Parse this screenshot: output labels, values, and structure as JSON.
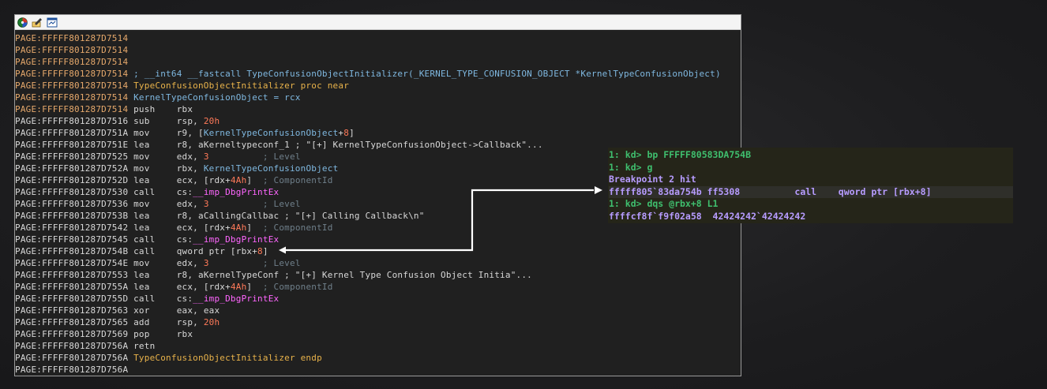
{
  "toolbar": {
    "icons": [
      "graph-view-icon",
      "edit-icon",
      "proximity-view-icon"
    ]
  },
  "disasm": [
    {
      "addr": "PAGE:FFFFF801287D7514",
      "addr_style": "user",
      "mnem": "",
      "ops": []
    },
    {
      "addr": "PAGE:FFFFF801287D7514",
      "addr_style": "user",
      "mnem": "",
      "ops": []
    },
    {
      "addr": "PAGE:FFFFF801287D7514",
      "addr_style": "user",
      "mnem": "",
      "ops": []
    },
    {
      "addr": "PAGE:FFFFF801287D7514",
      "addr_style": "user",
      "mnem": "",
      "ops": [
        {
          "t": "; __int64 __fastcall TypeConfusionObjectInitializer(_KERNEL_TYPE_CONFUSION_OBJECT *KernelTypeConfusionObject)",
          "c": "sym"
        }
      ]
    },
    {
      "addr": "PAGE:FFFFF801287D7514",
      "addr_style": "user",
      "mnem": "",
      "ops": [
        {
          "t": "TypeConfusionObjectInitializer proc near",
          "c": "proc"
        }
      ]
    },
    {
      "addr": "PAGE:FFFFF801287D7514",
      "addr_style": "user",
      "mnem": "",
      "ops": [
        {
          "t": "KernelTypeConfusionObject = rcx",
          "c": "sym"
        }
      ]
    },
    {
      "addr": "PAGE:FFFFF801287D7514",
      "addr_style": "user",
      "mnem": "push",
      "ops": [
        {
          "t": "rbx",
          "c": "op"
        }
      ]
    },
    {
      "addr": "PAGE:FFFFF801287D7516",
      "addr_style": "plain",
      "mnem": "sub",
      "ops": [
        {
          "t": "rsp, ",
          "c": "op"
        },
        {
          "t": "20h",
          "c": "num"
        }
      ]
    },
    {
      "addr": "PAGE:FFFFF801287D751A",
      "addr_style": "plain",
      "mnem": "mov",
      "ops": [
        {
          "t": "r9, [",
          "c": "op"
        },
        {
          "t": "KernelTypeConfusionObject",
          "c": "sym"
        },
        {
          "t": "+",
          "c": "op"
        },
        {
          "t": "8",
          "c": "num"
        },
        {
          "t": "]",
          "c": "op"
        }
      ]
    },
    {
      "addr": "PAGE:FFFFF801287D751E",
      "addr_style": "plain",
      "mnem": "lea",
      "ops": [
        {
          "t": "r8, aKerneltypeconf_1 ; \"[+] KernelTypeConfusionObject->Callback\"...",
          "c": "op"
        }
      ]
    },
    {
      "addr": "PAGE:FFFFF801287D7525",
      "addr_style": "plain",
      "mnem": "mov",
      "ops": [
        {
          "t": "edx, ",
          "c": "op"
        },
        {
          "t": "3",
          "c": "num"
        },
        {
          "t": "          ; Level",
          "c": "cmt"
        }
      ]
    },
    {
      "addr": "PAGE:FFFFF801287D752A",
      "addr_style": "plain",
      "mnem": "mov",
      "ops": [
        {
          "t": "rbx, ",
          "c": "op"
        },
        {
          "t": "KernelTypeConfusionObject",
          "c": "sym"
        }
      ]
    },
    {
      "addr": "PAGE:FFFFF801287D752D",
      "addr_style": "plain",
      "mnem": "lea",
      "ops": [
        {
          "t": "ecx, [rdx+",
          "c": "op"
        },
        {
          "t": "4Ah",
          "c": "num"
        },
        {
          "t": "]",
          "c": "op"
        },
        {
          "t": "  ; ComponentId",
          "c": "cmt"
        }
      ]
    },
    {
      "addr": "PAGE:FFFFF801287D7530",
      "addr_style": "plain",
      "mnem": "call",
      "ops": [
        {
          "t": "cs:",
          "c": "cs"
        },
        {
          "t": "__imp_DbgPrintEx",
          "c": "func"
        }
      ]
    },
    {
      "addr": "PAGE:FFFFF801287D7536",
      "addr_style": "plain",
      "mnem": "mov",
      "ops": [
        {
          "t": "edx, ",
          "c": "op"
        },
        {
          "t": "3",
          "c": "num"
        },
        {
          "t": "          ; Level",
          "c": "cmt"
        }
      ]
    },
    {
      "addr": "PAGE:FFFFF801287D753B",
      "addr_style": "plain",
      "mnem": "lea",
      "ops": [
        {
          "t": "r8, aCallingCallbac ; \"[+] Calling Callback\\n\"",
          "c": "op"
        }
      ]
    },
    {
      "addr": "PAGE:FFFFF801287D7542",
      "addr_style": "plain",
      "mnem": "lea",
      "ops": [
        {
          "t": "ecx, [rdx+",
          "c": "op"
        },
        {
          "t": "4Ah",
          "c": "num"
        },
        {
          "t": "]",
          "c": "op"
        },
        {
          "t": "  ; ComponentId",
          "c": "cmt"
        }
      ]
    },
    {
      "addr": "PAGE:FFFFF801287D7545",
      "addr_style": "plain",
      "mnem": "call",
      "ops": [
        {
          "t": "cs:",
          "c": "cs"
        },
        {
          "t": "__imp_DbgPrintEx",
          "c": "func"
        }
      ]
    },
    {
      "addr": "PAGE:FFFFF801287D754B",
      "addr_style": "plain",
      "mnem": "call",
      "ops": [
        {
          "t": "qword ptr [rbx+",
          "c": "op"
        },
        {
          "t": "8",
          "c": "num"
        },
        {
          "t": "]",
          "c": "op"
        }
      ]
    },
    {
      "addr": "PAGE:FFFFF801287D754E",
      "addr_style": "plain",
      "mnem": "mov",
      "ops": [
        {
          "t": "edx, ",
          "c": "op"
        },
        {
          "t": "3",
          "c": "num"
        },
        {
          "t": "          ; Level",
          "c": "cmt"
        }
      ]
    },
    {
      "addr": "PAGE:FFFFF801287D7553",
      "addr_style": "plain",
      "mnem": "lea",
      "ops": [
        {
          "t": "r8, aKernelTypeConf ; \"[+] Kernel Type Confusion Object Initia\"...",
          "c": "op"
        }
      ]
    },
    {
      "addr": "PAGE:FFFFF801287D755A",
      "addr_style": "plain",
      "mnem": "lea",
      "ops": [
        {
          "t": "ecx, [rdx+",
          "c": "op"
        },
        {
          "t": "4Ah",
          "c": "num"
        },
        {
          "t": "]",
          "c": "op"
        },
        {
          "t": "  ; ComponentId",
          "c": "cmt"
        }
      ]
    },
    {
      "addr": "PAGE:FFFFF801287D755D",
      "addr_style": "plain",
      "mnem": "call",
      "ops": [
        {
          "t": "cs:",
          "c": "cs"
        },
        {
          "t": "__imp_DbgPrintEx",
          "c": "func"
        }
      ]
    },
    {
      "addr": "PAGE:FFFFF801287D7563",
      "addr_style": "plain",
      "mnem": "xor",
      "ops": [
        {
          "t": "eax, eax",
          "c": "op"
        }
      ]
    },
    {
      "addr": "PAGE:FFFFF801287D7565",
      "addr_style": "plain",
      "mnem": "add",
      "ops": [
        {
          "t": "rsp, ",
          "c": "op"
        },
        {
          "t": "20h",
          "c": "num"
        }
      ]
    },
    {
      "addr": "PAGE:FFFFF801287D7569",
      "addr_style": "plain",
      "mnem": "pop",
      "ops": [
        {
          "t": "rbx",
          "c": "op"
        }
      ]
    },
    {
      "addr": "PAGE:FFFFF801287D756A",
      "addr_style": "plain",
      "mnem": "retn",
      "ops": []
    },
    {
      "addr": "PAGE:FFFFF801287D756A",
      "addr_style": "plain",
      "mnem": "",
      "ops": [
        {
          "t": "TypeConfusionObjectInitializer endp",
          "c": "proc"
        }
      ]
    },
    {
      "addr": "PAGE:FFFFF801287D756A",
      "addr_style": "plain",
      "mnem": "",
      "ops": []
    }
  ],
  "windbg": [
    {
      "text": "1: kd> bp FFFFF80583DA754B",
      "kind": "cmd",
      "hl": false
    },
    {
      "text": "1: kd> g",
      "kind": "cmd",
      "hl": false
    },
    {
      "text": "Breakpoint 2 hit",
      "kind": "out",
      "hl": false
    },
    {
      "text": "fffff805`83da754b ff5308          call    qword ptr [rbx+8]",
      "kind": "out",
      "hl": true
    },
    {
      "text": "1: kd> dqs @rbx+8 L1",
      "kind": "cmd",
      "hl": false
    },
    {
      "text": "ffffcf8f`f9f02a58  42424242`42424242",
      "kind": "out",
      "hl": false
    }
  ],
  "colors": {
    "user_addr": "#e5a86b",
    "plain_addr": "#d8d8d8",
    "windbg_cmd": "#3fbf6e",
    "windbg_out": "#b79cff",
    "arrow": "#ffffff"
  }
}
